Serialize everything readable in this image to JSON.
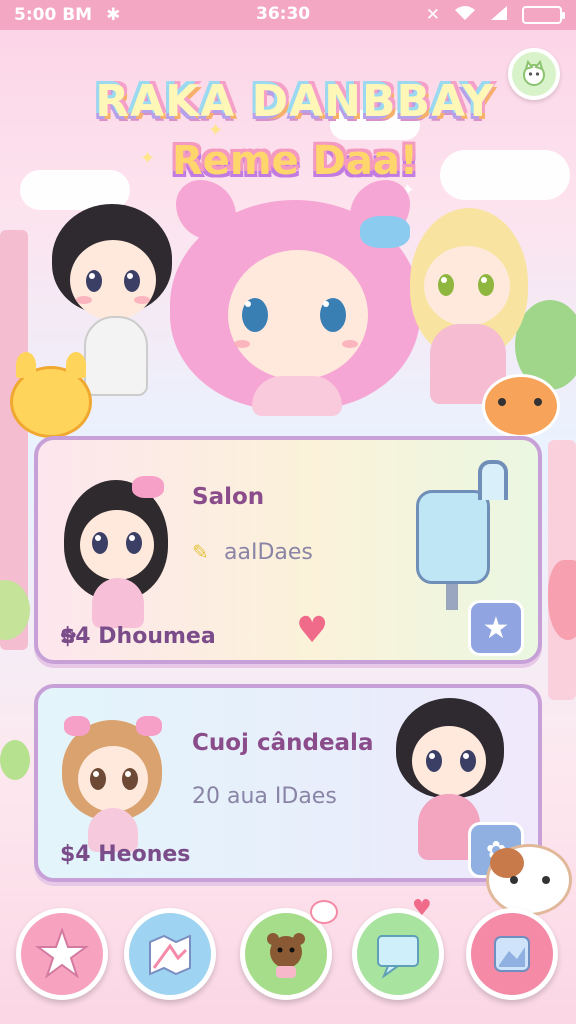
{
  "status_bar": {
    "left_time": "5:00 BM",
    "center_time": "36:30"
  },
  "header": {
    "title_line1": "RAKA DANBBAY",
    "title_line2": "Reme Daa!"
  },
  "cards": [
    {
      "title": "Salon",
      "subtitle": "aaIDaes",
      "footer": "$4 Dhoumea"
    },
    {
      "title": "Cuoj cândeala",
      "subtitle": "20 aua IDaes",
      "footer": "$4 Heones"
    }
  ],
  "icons": {
    "corner": "cat-house-icon",
    "nav": [
      "star-icon",
      "map-icon",
      "bear-icon",
      "chat-icon",
      "photo-icon"
    ]
  },
  "colors": {
    "status_bar": "#f3a7c3",
    "card_border": "#c7a0d8",
    "nav_pink": "#f7a3c0",
    "nav_blue": "#9fd3f2",
    "nav_green": "#a6dd8a",
    "nav_teal": "#a8e3a0"
  }
}
